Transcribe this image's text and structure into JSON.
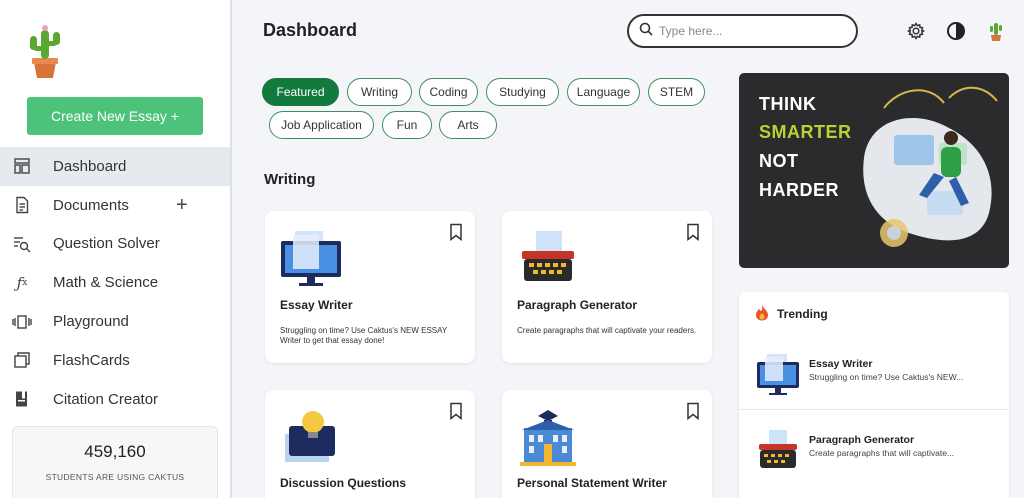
{
  "sidebar": {
    "create_button": "Create New Essay +",
    "items": [
      {
        "label": "Dashboard",
        "icon": "dashboard-icon"
      },
      {
        "label": "Documents",
        "icon": "document-icon",
        "action": "+"
      },
      {
        "label": "Question Solver",
        "icon": "question-search-icon"
      },
      {
        "label": "Math & Science",
        "icon": "function-icon"
      },
      {
        "label": "Playground",
        "icon": "playground-icon"
      },
      {
        "label": "FlashCards",
        "icon": "flashcards-icon"
      },
      {
        "label": "Citation Creator",
        "icon": "citation-icon"
      }
    ],
    "stat": {
      "number": "459,160",
      "label": "STUDENTS ARE USING CAKTUS"
    }
  },
  "header": {
    "title": "Dashboard",
    "search_placeholder": "Type here..."
  },
  "chips": [
    "Featured",
    "Writing",
    "Coding",
    "Studying",
    "Language",
    "STEM",
    "Job Application",
    "Fun",
    "Arts"
  ],
  "section_title": "Writing",
  "cards": [
    {
      "title": "Essay Writer",
      "desc": "Struggling on time? Use Caktus's NEW ESSAY Writer to get that essay done!",
      "icon": "monitor-icon"
    },
    {
      "title": "Paragraph Generator",
      "desc": "Create paragraphs that will captivate your readers.",
      "icon": "typewriter-icon"
    },
    {
      "title": "Discussion Questions",
      "desc": "",
      "icon": "lightbulb-icon"
    },
    {
      "title": "Personal Statement Writer",
      "desc": "",
      "icon": "university-icon"
    }
  ],
  "banner": {
    "line1": "THINK",
    "line2": "SMARTER",
    "line3": "NOT",
    "line4": "HARDER"
  },
  "trending": {
    "heading": "Trending",
    "items": [
      {
        "title": "Essay Writer",
        "desc": "Struggling on time? Use Caktus's NEW..."
      },
      {
        "title": "Paragraph Generator",
        "desc": "Create paragraphs that will captivate..."
      }
    ]
  },
  "colors": {
    "accent_green": "#4cc27a",
    "chip_active": "#137a3e",
    "banner_bg": "#2b2b2e",
    "banner_highlight": "#b5d334"
  }
}
